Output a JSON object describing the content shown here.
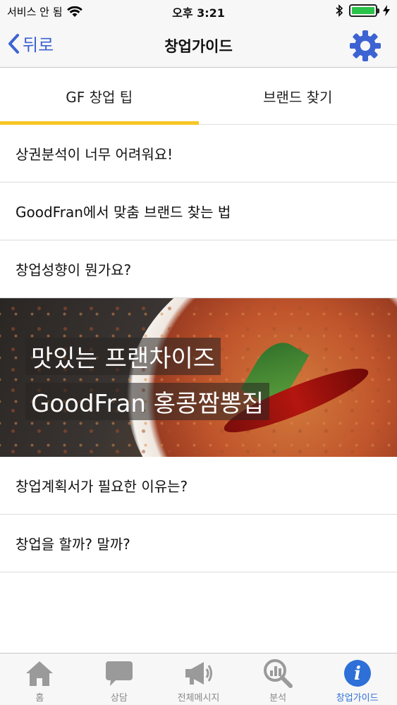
{
  "status_bar": {
    "carrier": "서비스 안 됨",
    "time": "오후 3:21",
    "battery_level": 1.0
  },
  "nav": {
    "back_label": "뒤로",
    "title": "창업가이드",
    "settings_icon": "gear-icon"
  },
  "tabs": [
    {
      "label": "GF 창업 팁",
      "active": true
    },
    {
      "label": "브랜드 찾기",
      "active": false
    }
  ],
  "list_top": [
    {
      "label": "상권분석이 너무 어려워요!"
    },
    {
      "label": "GoodFran에서 맞춤 브랜드 찾는 법"
    },
    {
      "label": "창업성향이 뭔가요?"
    }
  ],
  "banner": {
    "line1": "맛있는 프랜차이즈",
    "line2": "GoodFran 홍콩짬뽕집"
  },
  "list_bottom": [
    {
      "label": "창업계획서가 필요한 이유는?"
    },
    {
      "label": "창업을 할까? 말까?"
    }
  ],
  "tab_bar": [
    {
      "label": "홈",
      "icon": "home-icon",
      "active": false
    },
    {
      "label": "상담",
      "icon": "chat-icon",
      "active": false
    },
    {
      "label": "전체메시지",
      "icon": "megaphone-icon",
      "active": false
    },
    {
      "label": "분석",
      "icon": "analysis-icon",
      "active": false
    },
    {
      "label": "창업가이드",
      "icon": "info-icon",
      "active": true
    }
  ],
  "colors": {
    "accent": "#3d63d2",
    "tab_indicator": "#f6c623",
    "active_tab": "#2e6fd8",
    "inactive_icon": "#9a9a9a"
  }
}
